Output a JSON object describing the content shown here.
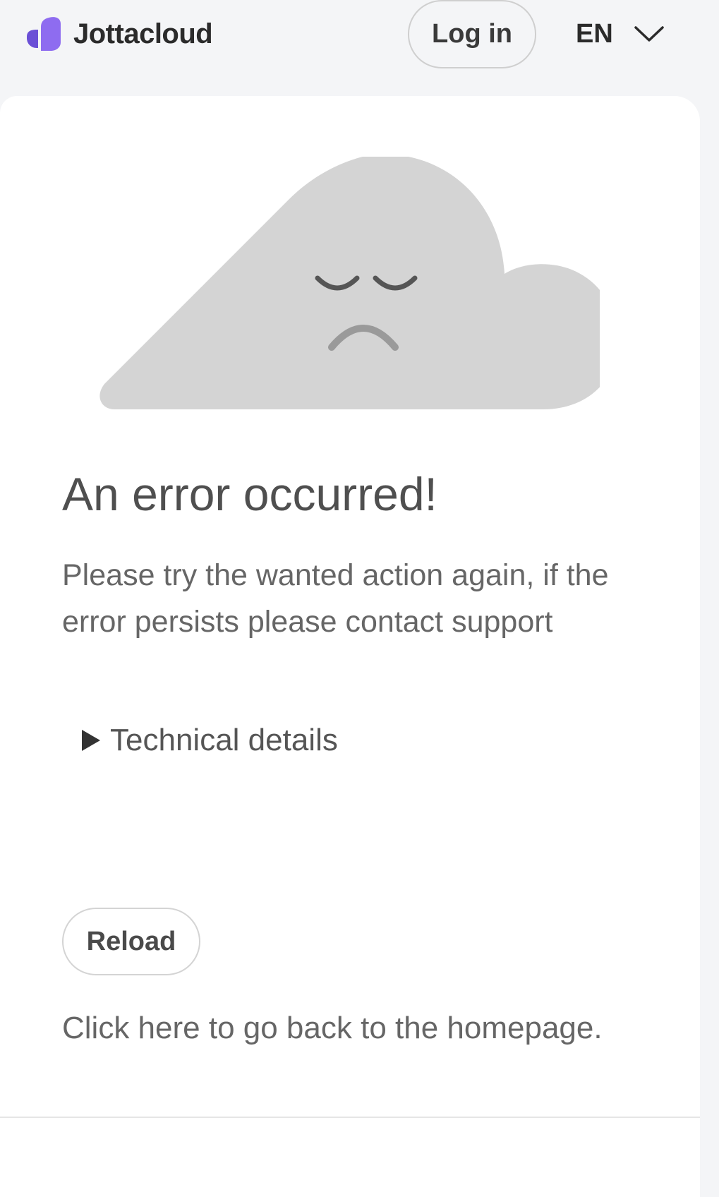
{
  "header": {
    "brand": "Jottacloud",
    "login_label": "Log in",
    "language": "EN"
  },
  "error": {
    "title": "An error occurred!",
    "message": "Please try the wanted action again, if the error persists please contact support",
    "details_label": "Technical details",
    "reload_label": "Reload",
    "home_link": "Click here to go back to the homepage."
  },
  "colors": {
    "brand_purple": "#7b5ce5",
    "cloud_gray": "#d4d4d4",
    "background": "#f4f5f7"
  },
  "icons": {
    "logo": "jottacloud-logo-icon",
    "language_dropdown": "chevron-down-icon",
    "details_toggle": "triangle-right-icon",
    "illustration": "sad-cloud-icon"
  }
}
